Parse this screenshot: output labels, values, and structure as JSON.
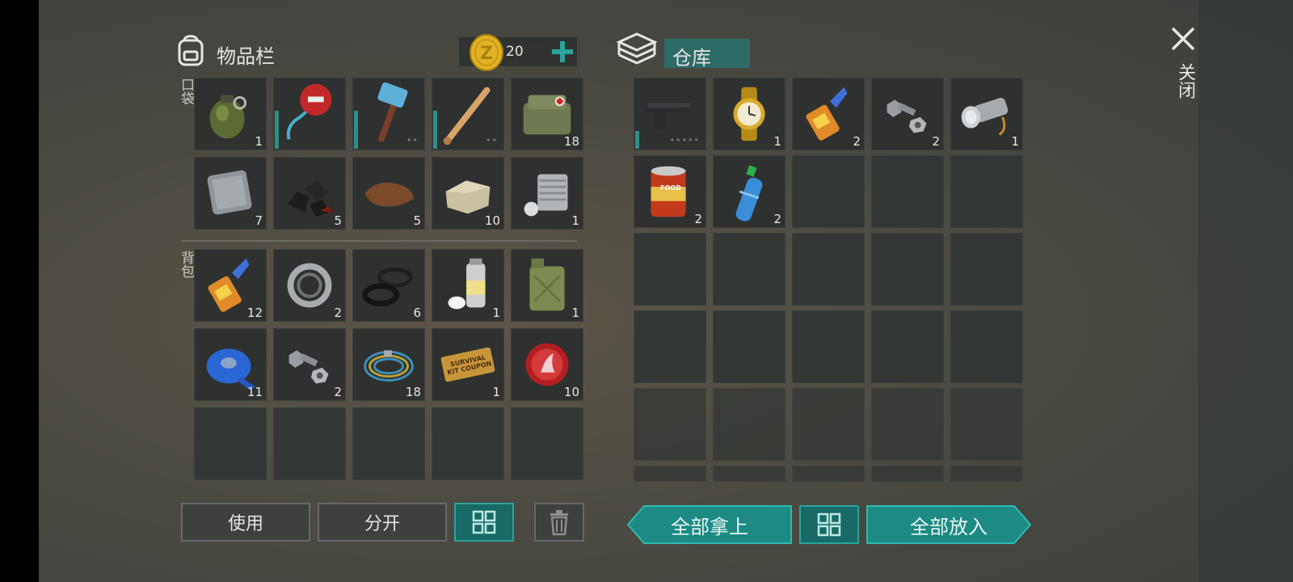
{
  "inventory": {
    "title": "物品栏",
    "coins": "20",
    "pockets_label": "口袋",
    "backpack_label": "背包"
  },
  "storage": {
    "title": "仓库"
  },
  "close_label": "关闭",
  "pockets": [
    {
      "icon": "grenade-icon",
      "count": "1"
    },
    {
      "icon": "stop-sign-icon",
      "count": "",
      "durability": 0.55
    },
    {
      "icon": "sledgehammer-icon",
      "count": "",
      "durability": 0.55,
      "dots": "••"
    },
    {
      "icon": "baseball-bat-icon",
      "count": "",
      "durability": 0.55,
      "dots": "••"
    },
    {
      "icon": "first-aid-bag-icon",
      "count": "18"
    },
    {
      "icon": "metal-plate-icon",
      "count": "7"
    },
    {
      "icon": "coal-icon",
      "count": "5"
    },
    {
      "icon": "leather-icon",
      "count": "5"
    },
    {
      "icon": "stone-icon",
      "count": "10"
    },
    {
      "icon": "engine-cylinder-icon",
      "count": "1"
    }
  ],
  "backpack": [
    {
      "icon": "glue-icon",
      "count": "12"
    },
    {
      "icon": "bearing-icon",
      "count": "2"
    },
    {
      "icon": "rubber-seals-icon",
      "count": "6"
    },
    {
      "icon": "spray-paint-icon",
      "count": "1"
    },
    {
      "icon": "jerrycan-icon",
      "count": "1"
    },
    {
      "icon": "duct-tape-icon",
      "count": "11"
    },
    {
      "icon": "bolt-nut-icon",
      "count": "2"
    },
    {
      "icon": "wire-icon",
      "count": "18"
    },
    {
      "icon": "coupon-icon",
      "count": "1",
      "text": "SURVIVAL KIT COUPON"
    },
    {
      "icon": "bottle-cap-icon",
      "count": "10"
    }
  ],
  "storage_items": [
    {
      "icon": "pistol-icon",
      "count": "",
      "durability": 0.25,
      "dots": "•••••"
    },
    {
      "icon": "gold-watch-icon",
      "count": "1"
    },
    {
      "icon": "glue-icon",
      "count": "2"
    },
    {
      "icon": "bolt-nut-icon",
      "count": "2"
    },
    {
      "icon": "flashlight-icon",
      "count": "1"
    },
    {
      "icon": "canned-food-icon",
      "count": "2",
      "text": "FOOD"
    },
    {
      "icon": "water-bottle-icon",
      "count": "2"
    }
  ],
  "buttons": {
    "use": "使用",
    "split": "分开",
    "take_all": "全部拿上",
    "put_all": "全部放入"
  },
  "colors": {
    "accent": "#2aa49c",
    "gold": "#e1b324"
  }
}
